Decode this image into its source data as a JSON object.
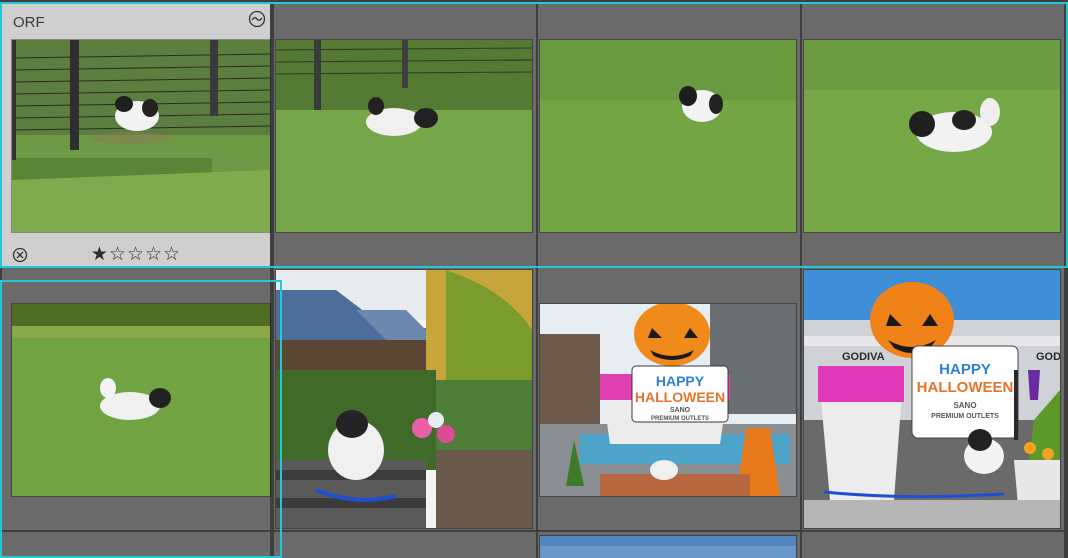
{
  "grid": {
    "cells": [
      {
        "id": "c1",
        "ext": "ORF",
        "stars": "★☆☆☆☆",
        "rating": 1,
        "scene": "dog-by-fence"
      },
      {
        "id": "c2",
        "scene": "dog-in-grass"
      },
      {
        "id": "c3",
        "scene": "dog-running"
      },
      {
        "id": "c4",
        "scene": "dog-walking"
      },
      {
        "id": "c5",
        "scene": "dog-on-lawn"
      },
      {
        "id": "c6",
        "scene": "dog-on-bench"
      },
      {
        "id": "c7",
        "scene": "halloween-pumpkin"
      },
      {
        "id": "c8",
        "scene": "halloween-sign"
      },
      {
        "id": "c9",
        "scene": "partial-thumbnail"
      }
    ],
    "halloween_sign": {
      "line1": "HAPPY",
      "line2": "HALLOWEEN",
      "line3": "SANO",
      "line4": "PREMIUM OUTLETS"
    },
    "store_sign": "GODIVA",
    "colors": {
      "selection": "#22c8d8",
      "cell_bg": "#6b6b6b",
      "selected_cell_bg": "#cfcfcf",
      "grid_bg": "#3f3f3f"
    },
    "icons": {
      "badge": "edited-badge-icon",
      "reject": "reject-flag-icon",
      "star": "star-icon"
    }
  }
}
